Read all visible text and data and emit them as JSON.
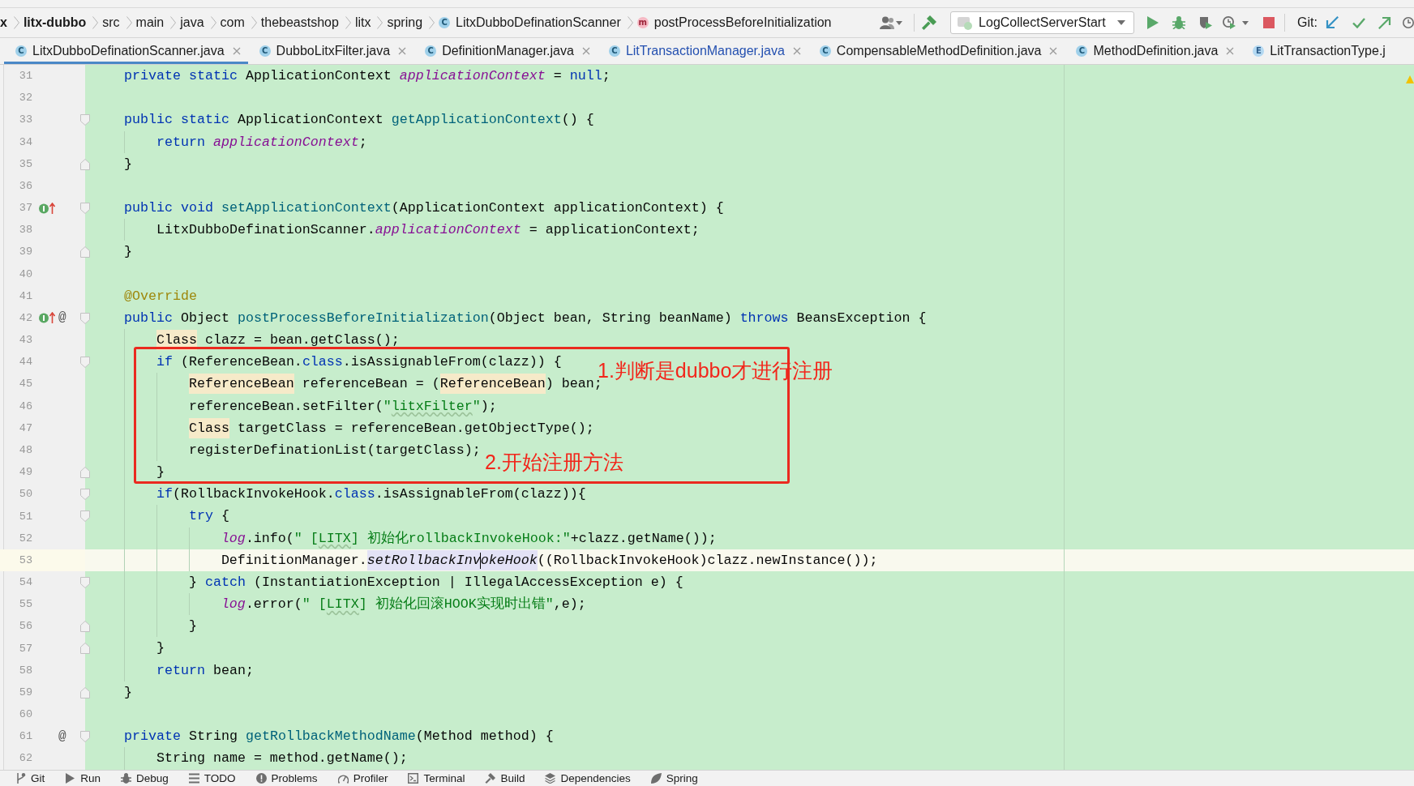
{
  "breadcrumbs": [
    {
      "label": "x",
      "kind": "module"
    },
    {
      "label": "litx-dubbo",
      "kind": "module"
    },
    {
      "label": "src",
      "kind": "directory"
    },
    {
      "label": "main",
      "kind": "directory"
    },
    {
      "label": "java",
      "kind": "directory"
    },
    {
      "label": "com",
      "kind": "directory"
    },
    {
      "label": "thebeastshop",
      "kind": "directory"
    },
    {
      "label": "litx",
      "kind": "directory"
    },
    {
      "label": "spring",
      "kind": "directory"
    },
    {
      "label": "LitxDubboDefinationScanner",
      "kind": "class",
      "icon": "C"
    },
    {
      "label": "postProcessBeforeInitialization",
      "kind": "method",
      "icon": "m"
    }
  ],
  "toolbar": {
    "run_configuration": "LogCollectServerStart",
    "vcs_label": "Git:"
  },
  "tabs": [
    {
      "label": "LitxDubboDefinationScanner.java",
      "kind": "class",
      "icon": "C",
      "selected": true,
      "modified": false,
      "closable": true
    },
    {
      "label": "DubboLitxFilter.java",
      "kind": "class",
      "icon": "C",
      "selected": false,
      "modified": false,
      "closable": true
    },
    {
      "label": "DefinitionManager.java",
      "kind": "class",
      "icon": "C",
      "selected": false,
      "modified": false,
      "closable": true
    },
    {
      "label": "LitTransactionManager.java",
      "kind": "class",
      "icon": "C",
      "selected": false,
      "modified": true,
      "closable": true
    },
    {
      "label": "CompensableMethodDefinition.java",
      "kind": "class",
      "icon": "C",
      "selected": false,
      "modified": false,
      "closable": true
    },
    {
      "label": "MethodDefinition.java",
      "kind": "class",
      "icon": "C",
      "selected": false,
      "modified": false,
      "closable": true
    },
    {
      "label": "LitTransactionType.j",
      "kind": "enum",
      "icon": "E",
      "selected": false,
      "modified": false,
      "closable": false
    }
  ],
  "editor": {
    "lines": [
      {
        "number": "31",
        "current": false,
        "code": [
          {
            "text": "    private static ",
            "kind": "keyword"
          },
          {
            "text": "ApplicationContext ",
            "kind": "plain"
          },
          {
            "text": "applicationContext",
            "kind": "static-field"
          },
          {
            "text": " = ",
            "kind": "plain"
          },
          {
            "text": "null",
            "kind": "keyword"
          },
          {
            "text": ";",
            "kind": "plain"
          }
        ]
      },
      {
        "number": "32",
        "current": false
      },
      {
        "number": "33",
        "current": false,
        "fold": {
          "kind": "open"
        },
        "code": [
          {
            "text": "    public static ",
            "kind": "keyword"
          },
          {
            "text": "ApplicationContext ",
            "kind": "plain"
          },
          {
            "text": "getApplicationContext",
            "kind": "method-declaration"
          },
          {
            "text": "() {",
            "kind": "plain"
          }
        ]
      },
      {
        "number": "34",
        "current": false,
        "code": [
          {
            "text": "        return ",
            "kind": "keyword"
          },
          {
            "text": "applicationContext",
            "kind": "static-field"
          },
          {
            "text": ";",
            "kind": "plain"
          }
        ]
      },
      {
        "number": "35",
        "current": false,
        "fold": {
          "kind": "close"
        },
        "code": [
          {
            "text": "    }",
            "kind": "plain"
          }
        ]
      },
      {
        "number": "36",
        "current": false
      },
      {
        "number": "37",
        "current": false,
        "fold": {
          "kind": "open"
        },
        "gutter": [
          {
            "kind": "implements"
          }
        ],
        "code": [
          {
            "text": "    public void ",
            "kind": "keyword"
          },
          {
            "text": "setApplicationContext",
            "kind": "method-declaration"
          },
          {
            "text": "(ApplicationContext applicationContext) {",
            "kind": "plain"
          }
        ]
      },
      {
        "number": "38",
        "current": false,
        "code": [
          {
            "text": "        LitxDubboDefinationScanner.",
            "kind": "plain"
          },
          {
            "text": "applicationContext",
            "kind": "static-field"
          },
          {
            "text": " = applicationContext;",
            "kind": "plain"
          }
        ]
      },
      {
        "number": "39",
        "current": false,
        "fold": {
          "kind": "close"
        },
        "code": [
          {
            "text": "    }",
            "kind": "plain"
          }
        ]
      },
      {
        "number": "40",
        "current": false
      },
      {
        "number": "41",
        "current": false,
        "code": [
          {
            "text": "    @Override",
            "kind": "annotation"
          }
        ]
      },
      {
        "number": "42",
        "current": false,
        "fold": {
          "kind": "open"
        },
        "gutter": [
          {
            "kind": "implements"
          },
          {
            "kind": "symbol",
            "text": "@"
          }
        ],
        "code": [
          {
            "text": "    public ",
            "kind": "keyword"
          },
          {
            "text": "Object ",
            "kind": "plain"
          },
          {
            "text": "postProcessBeforeInitialization",
            "kind": "method-declaration"
          },
          {
            "text": "(Object bean, String beanName) ",
            "kind": "plain"
          },
          {
            "text": "throws ",
            "kind": "keyword"
          },
          {
            "text": "BeansException {",
            "kind": "plain"
          }
        ]
      },
      {
        "number": "43",
        "current": false,
        "code": [
          {
            "text": "        Class",
            "kind": "raw-type"
          },
          {
            "text": " clazz = bean.getClass();",
            "kind": "plain"
          }
        ]
      },
      {
        "number": "44",
        "current": false,
        "fold": {
          "kind": "open"
        },
        "code": [
          {
            "text": "        if ",
            "kind": "keyword"
          },
          {
            "text": "(ReferenceBean.",
            "kind": "plain"
          },
          {
            "text": "class",
            "kind": "keyword"
          },
          {
            "text": ".isAssignableFrom(clazz)) {",
            "kind": "plain"
          }
        ]
      },
      {
        "number": "45",
        "current": false,
        "code": [
          {
            "text": "            ReferenceBean",
            "kind": "raw-type"
          },
          {
            "text": " referenceBean = (",
            "kind": "plain"
          },
          {
            "text": "ReferenceBean",
            "kind": "raw-type"
          },
          {
            "text": ") bean;",
            "kind": "plain"
          }
        ]
      },
      {
        "number": "46",
        "current": false,
        "code": [
          {
            "text": "            referenceBean.setFilter(",
            "kind": "plain"
          },
          {
            "text": "\"",
            "kind": "string"
          },
          {
            "text": "litxFilter",
            "kind": "string-typo"
          },
          {
            "text": "\"",
            "kind": "string"
          },
          {
            "text": ");",
            "kind": "plain"
          }
        ]
      },
      {
        "number": "47",
        "current": false,
        "code": [
          {
            "text": "            Class",
            "kind": "raw-type"
          },
          {
            "text": " targetClass = referenceBean.getObjectType();",
            "kind": "plain"
          }
        ]
      },
      {
        "number": "48",
        "current": false,
        "code": [
          {
            "text": "            registerDefinationList(targetClass);",
            "kind": "plain"
          }
        ]
      },
      {
        "number": "49",
        "current": false,
        "fold": {
          "kind": "close"
        },
        "code": [
          {
            "text": "        }",
            "kind": "plain"
          }
        ]
      },
      {
        "number": "50",
        "current": false,
        "fold": {
          "kind": "open"
        },
        "code": [
          {
            "text": "        if",
            "kind": "keyword"
          },
          {
            "text": "(RollbackInvokeHook.",
            "kind": "plain"
          },
          {
            "text": "class",
            "kind": "keyword"
          },
          {
            "text": ".isAssignableFrom(clazz)){",
            "kind": "plain"
          }
        ]
      },
      {
        "number": "51",
        "current": false,
        "fold": {
          "kind": "open"
        },
        "code": [
          {
            "text": "            try",
            "kind": "keyword"
          },
          {
            "text": " {",
            "kind": "plain"
          }
        ]
      },
      {
        "number": "52",
        "current": false,
        "code": [
          {
            "text": "                log",
            "kind": "static-field"
          },
          {
            "text": ".info(",
            "kind": "plain"
          },
          {
            "text": "\" [",
            "kind": "string"
          },
          {
            "text": "LITX",
            "kind": "string-typo"
          },
          {
            "text": "] 初始化rollbackInvokeHook:\"",
            "kind": "string"
          },
          {
            "text": "+clazz.getName());",
            "kind": "plain"
          }
        ]
      },
      {
        "number": "53",
        "current": true,
        "code": [
          {
            "text": "                DefinitionManager.",
            "kind": "plain"
          },
          {
            "text": "setRollbackInv",
            "kind": "static-call-highlighted"
          },
          {
            "kind": "caret"
          },
          {
            "text": "okeHook",
            "kind": "static-call-highlighted"
          },
          {
            "text": "((RollbackInvokeHook)clazz.newInstance());",
            "kind": "plain"
          }
        ]
      },
      {
        "number": "54",
        "current": false,
        "fold": {
          "kind": "open"
        },
        "code": [
          {
            "text": "            } ",
            "kind": "plain"
          },
          {
            "text": "catch",
            "kind": "keyword"
          },
          {
            "text": " (InstantiationException | IllegalAccessException e) {",
            "kind": "plain"
          }
        ]
      },
      {
        "number": "55",
        "current": false,
        "code": [
          {
            "text": "                log",
            "kind": "static-field"
          },
          {
            "text": ".error(",
            "kind": "plain"
          },
          {
            "text": "\" [",
            "kind": "string"
          },
          {
            "text": "LITX",
            "kind": "string-typo"
          },
          {
            "text": "] 初始化回滚HOOK实现时出错\"",
            "kind": "string"
          },
          {
            "text": ",e);",
            "kind": "plain"
          }
        ]
      },
      {
        "number": "56",
        "current": false,
        "fold": {
          "kind": "close"
        },
        "code": [
          {
            "text": "            }",
            "kind": "plain"
          }
        ]
      },
      {
        "number": "57",
        "current": false,
        "fold": {
          "kind": "close"
        },
        "code": [
          {
            "text": "        }",
            "kind": "plain"
          }
        ]
      },
      {
        "number": "58",
        "current": false,
        "code": [
          {
            "text": "        return ",
            "kind": "keyword"
          },
          {
            "text": "bean;",
            "kind": "plain"
          }
        ]
      },
      {
        "number": "59",
        "current": false,
        "fold": {
          "kind": "close"
        },
        "code": [
          {
            "text": "    }",
            "kind": "plain"
          }
        ]
      },
      {
        "number": "60",
        "current": false
      },
      {
        "number": "61",
        "current": false,
        "fold": {
          "kind": "open"
        },
        "gutter": [
          {
            "kind": "symbol",
            "text": "@"
          }
        ],
        "code": [
          {
            "text": "    private ",
            "kind": "keyword"
          },
          {
            "text": "String ",
            "kind": "plain"
          },
          {
            "text": "getRollbackMethodName",
            "kind": "method-declaration"
          },
          {
            "text": "(Method method) {",
            "kind": "plain"
          }
        ]
      },
      {
        "number": "62",
        "current": false,
        "code": [
          {
            "text": "        String name = method.getName();",
            "kind": "plain"
          }
        ]
      }
    ],
    "annotations": [
      {
        "text": "1.判断是dubbo才进行注册"
      },
      {
        "text": "2.开始注册方法"
      }
    ]
  },
  "tool_windows": [
    {
      "label": "Git"
    },
    {
      "label": "Run"
    },
    {
      "label": "Debug"
    },
    {
      "label": "TODO"
    },
    {
      "label": "Problems"
    },
    {
      "label": "Profiler"
    },
    {
      "label": "Terminal"
    },
    {
      "label": "Build"
    },
    {
      "label": "Dependencies"
    },
    {
      "label": "Spring"
    }
  ]
}
